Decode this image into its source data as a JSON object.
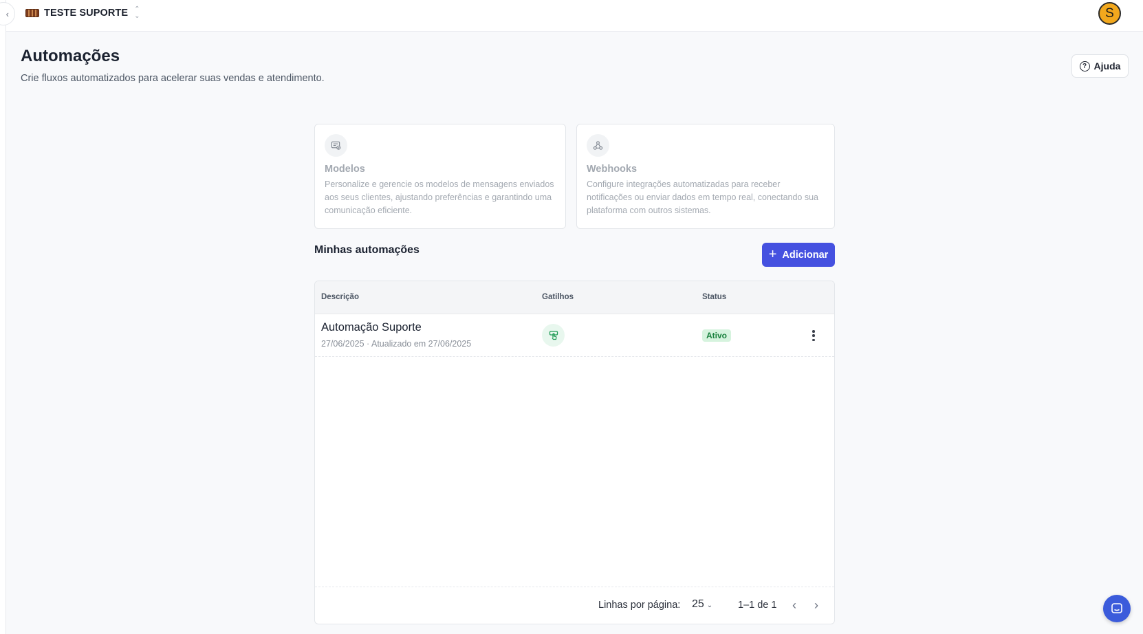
{
  "topbar": {
    "workspace_name": "TESTE SUPORTE",
    "avatar_initial": "S"
  },
  "header": {
    "title": "Automações",
    "subtitle": "Crie fluxos automatizados para acelerar suas vendas e atendimento.",
    "help_label": "Ajuda"
  },
  "cards": [
    {
      "title": "Modelos",
      "description": "Personalize e gerencie os modelos de mensagens enviados aos seus clientes, ajustando preferências e garantindo uma comunicação eficiente.",
      "icon": "template-icon"
    },
    {
      "title": "Webhooks",
      "description": "Configure integrações automatizadas para receber notificações ou enviar dados em tempo real, conectando sua plataforma com outros sistemas.",
      "icon": "webhook-icon"
    }
  ],
  "automations": {
    "section_title": "Minhas automações",
    "add_label": "Adicionar",
    "columns": [
      "Descrição",
      "Gatilhos",
      "Status"
    ],
    "rows": [
      {
        "title": "Automação Suporte",
        "meta": "27/06/2025 · Atualizado em 27/06/2025",
        "trigger_icon": "touch-trigger-icon",
        "status": "Ativo"
      }
    ],
    "footer": {
      "rows_per_page_label": "Linhas por página:",
      "rows_per_page_value": "25",
      "range": "1–1 de 1"
    }
  },
  "colors": {
    "primary": "#4551e0",
    "status_active_bg": "#d6f3de",
    "status_active_text": "#19803d",
    "avatar_bg": "#f2a81d",
    "chat_bubble": "#3b5bdb"
  }
}
